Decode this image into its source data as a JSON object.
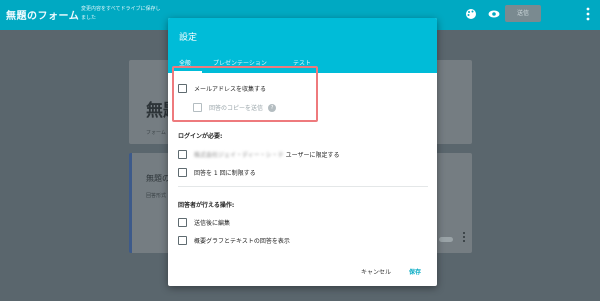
{
  "app": {
    "title": "無題のフォーム",
    "save_status": "変更内容をすべてドライブに保存しました",
    "send_label": "送信",
    "icons": [
      "palette-icon",
      "eye-icon",
      "gear-icon",
      "more-vert-icon"
    ]
  },
  "background": {
    "form_title": "無題",
    "form_subtitle": "フォーム",
    "question_title": "無題の",
    "question_subtitle": "回答形式"
  },
  "dialog": {
    "title": "設定",
    "tabs": [
      {
        "label": "全般",
        "active": true
      },
      {
        "label": "プレゼンテーション",
        "active": false
      },
      {
        "label": "テスト",
        "active": false
      }
    ],
    "general": {
      "collect_email": "メールアドレスを収集する",
      "send_copy": "回答のコピーを送信",
      "login_required_label": "ログインが必要:",
      "restrict_domain_blurred": "株式会社ジェイ・ディー・シ・テ",
      "restrict_domain_suffix": "ユーザーに限定する",
      "limit_one_response": "回答を 1 回に制限する",
      "respondents_label": "回答者が行える操作:",
      "edit_after_submit": "送信後に編集",
      "see_summary": "概要グラフとテキストの回答を表示"
    },
    "buttons": {
      "cancel": "キャンセル",
      "save": "保存"
    }
  },
  "colors": {
    "header": "#00bcd8",
    "accent": "#00a9c2",
    "highlight_border": "#ee7a7d"
  }
}
